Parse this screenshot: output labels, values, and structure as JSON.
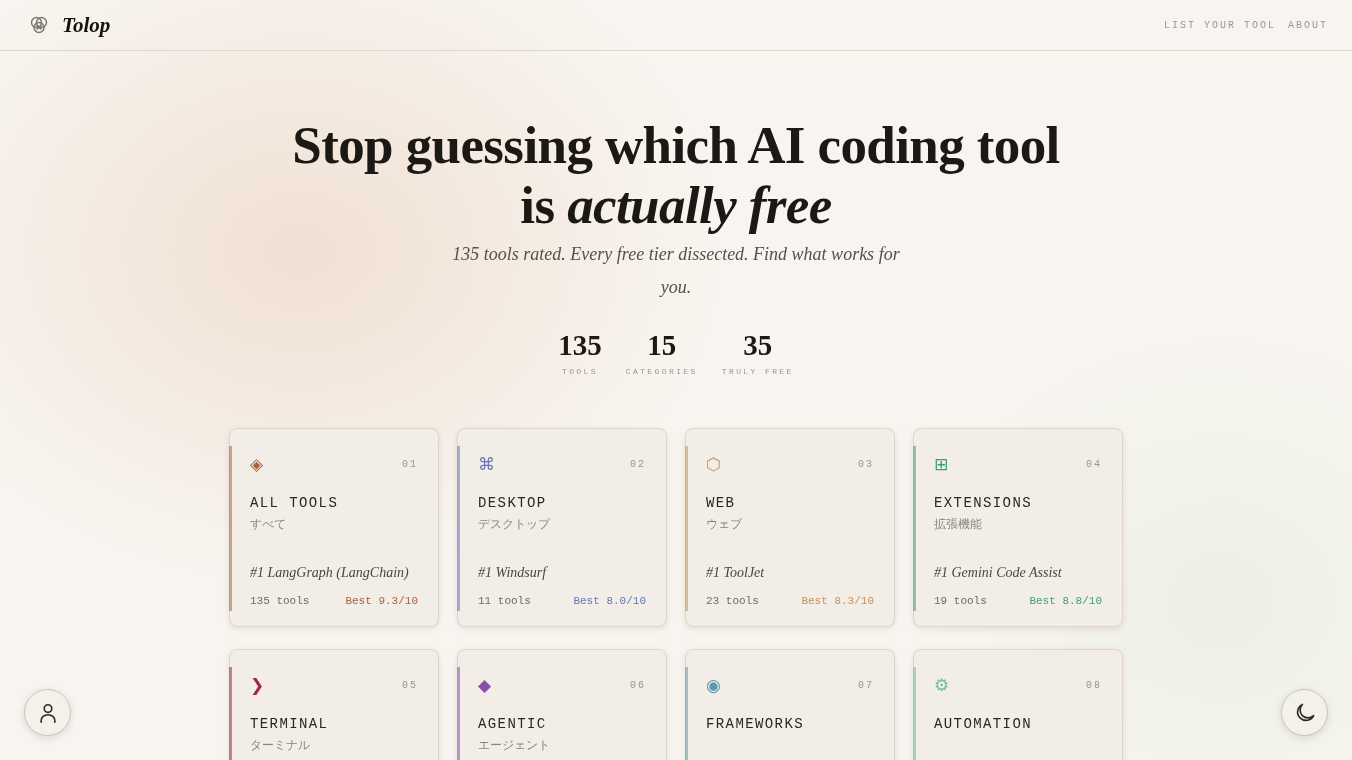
{
  "header": {
    "brand": "Tolop",
    "nav": [
      "LIST YOUR TOOL",
      "ABOUT"
    ]
  },
  "hero": {
    "title": "Stop guessing which AI coding tool is *actually free*",
    "subtitle": "135 tools rated. Every free tier dissected. Find what works for you."
  },
  "stats": [
    {
      "value": "135",
      "label": "TOOLS"
    },
    {
      "value": "15",
      "label": "CATEGORIES"
    },
    {
      "value": "35",
      "label": "TRULY FREE"
    }
  ],
  "categories": [
    {
      "icon": "◈",
      "number": "01",
      "name": "ALL TOOLS",
      "name_ja": "すべて",
      "top_tool": "#1 LangGraph (LangChain)",
      "count": "135 tools",
      "best": "Best 9.3/10",
      "color": "#a8643c"
    },
    {
      "icon": "⌘",
      "number": "02",
      "name": "DESKTOP",
      "name_ja": "デスクトップ",
      "top_tool": "#1 Windsurf",
      "count": "11 tools",
      "best": "Best 8.0/10",
      "color": "#6478b8"
    },
    {
      "icon": "⬡",
      "number": "03",
      "name": "WEB",
      "name_ja": "ウェブ",
      "top_tool": "#1 ToolJet",
      "count": "23 tools",
      "best": "Best 8.3/10",
      "color": "#c8925a"
    },
    {
      "icon": "⊞",
      "number": "04",
      "name": "EXTENSIONS",
      "name_ja": "拡張機能",
      "top_tool": "#1 Gemini Code Assist",
      "count": "19 tools",
      "best": "Best 8.8/10",
      "color": "#3f9f6f"
    },
    {
      "icon": "❯",
      "number": "05",
      "name": "TERMINAL",
      "name_ja": "ターミナル",
      "color": "#a3283f"
    },
    {
      "icon": "◆",
      "number": "06",
      "name": "AGENTIC",
      "name_ja": "エージェント",
      "color": "#8b4ea6"
    },
    {
      "icon": "◉",
      "number": "07",
      "name": "FRAMEWORKS",
      "color": "#5b9bb0"
    },
    {
      "icon": "⚙",
      "number": "08",
      "name": "AUTOMATION",
      "color": "#6cc08a"
    }
  ]
}
